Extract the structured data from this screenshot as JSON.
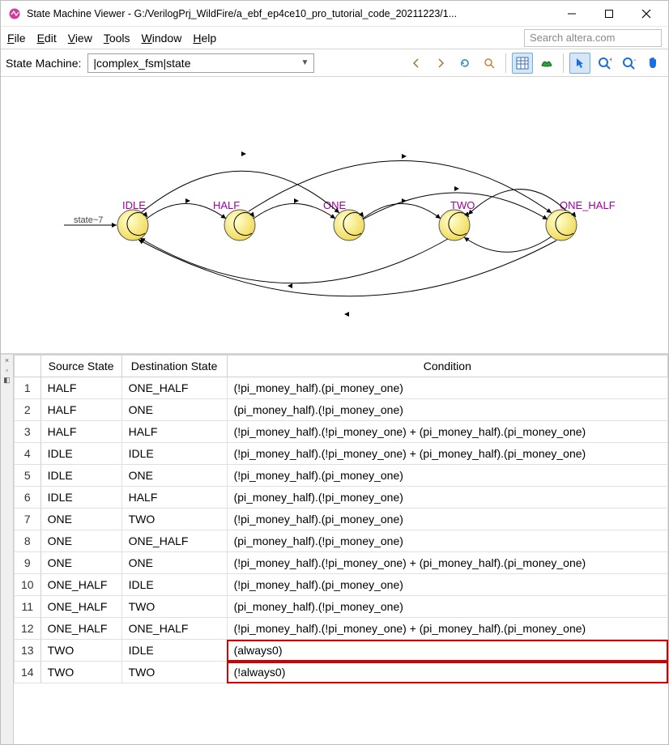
{
  "window": {
    "title": "State Machine Viewer - G:/VerilogPrj_WildFire/a_ebf_ep4ce10_pro_tutorial_code_20211223/1..."
  },
  "menu": {
    "file": "File",
    "edit": "Edit",
    "view": "View",
    "tools": "Tools",
    "window": "Window",
    "help": "Help",
    "search_placeholder": "Search altera.com"
  },
  "toolbar": {
    "label": "State Machine:",
    "combo_value": "|complex_fsm|state"
  },
  "diagram": {
    "start_label": "state~7",
    "states": {
      "idle": "IDLE",
      "half": "HALF",
      "one": "ONE",
      "two": "TWO",
      "one_half": "ONE_HALF"
    }
  },
  "table": {
    "headers": {
      "src": "Source State",
      "dst": "Destination State",
      "cond": "Condition"
    },
    "rows": [
      {
        "n": "1",
        "src": "HALF",
        "dst": "ONE_HALF",
        "cond": "(!pi_money_half).(pi_money_one)",
        "hl": false
      },
      {
        "n": "2",
        "src": "HALF",
        "dst": "ONE",
        "cond": "(pi_money_half).(!pi_money_one)",
        "hl": false
      },
      {
        "n": "3",
        "src": "HALF",
        "dst": "HALF",
        "cond": "(!pi_money_half).(!pi_money_one) + (pi_money_half).(pi_money_one)",
        "hl": false
      },
      {
        "n": "4",
        "src": "IDLE",
        "dst": "IDLE",
        "cond": "(!pi_money_half).(!pi_money_one) + (pi_money_half).(pi_money_one)",
        "hl": false
      },
      {
        "n": "5",
        "src": "IDLE",
        "dst": "ONE",
        "cond": "(!pi_money_half).(pi_money_one)",
        "hl": false
      },
      {
        "n": "6",
        "src": "IDLE",
        "dst": "HALF",
        "cond": "(pi_money_half).(!pi_money_one)",
        "hl": false
      },
      {
        "n": "7",
        "src": "ONE",
        "dst": "TWO",
        "cond": "(!pi_money_half).(pi_money_one)",
        "hl": false
      },
      {
        "n": "8",
        "src": "ONE",
        "dst": "ONE_HALF",
        "cond": "(pi_money_half).(!pi_money_one)",
        "hl": false
      },
      {
        "n": "9",
        "src": "ONE",
        "dst": "ONE",
        "cond": "(!pi_money_half).(!pi_money_one) + (pi_money_half).(pi_money_one)",
        "hl": false
      },
      {
        "n": "10",
        "src": "ONE_HALF",
        "dst": "IDLE",
        "cond": "(!pi_money_half).(pi_money_one)",
        "hl": false
      },
      {
        "n": "11",
        "src": "ONE_HALF",
        "dst": "TWO",
        "cond": "(pi_money_half).(!pi_money_one)",
        "hl": false
      },
      {
        "n": "12",
        "src": "ONE_HALF",
        "dst": "ONE_HALF",
        "cond": "(!pi_money_half).(!pi_money_one) + (pi_money_half).(pi_money_one)",
        "hl": false
      },
      {
        "n": "13",
        "src": "TWO",
        "dst": "IDLE",
        "cond": "(always0)",
        "hl": true
      },
      {
        "n": "14",
        "src": "TWO",
        "dst": "TWO",
        "cond": "(!always0)",
        "hl": true
      }
    ]
  }
}
